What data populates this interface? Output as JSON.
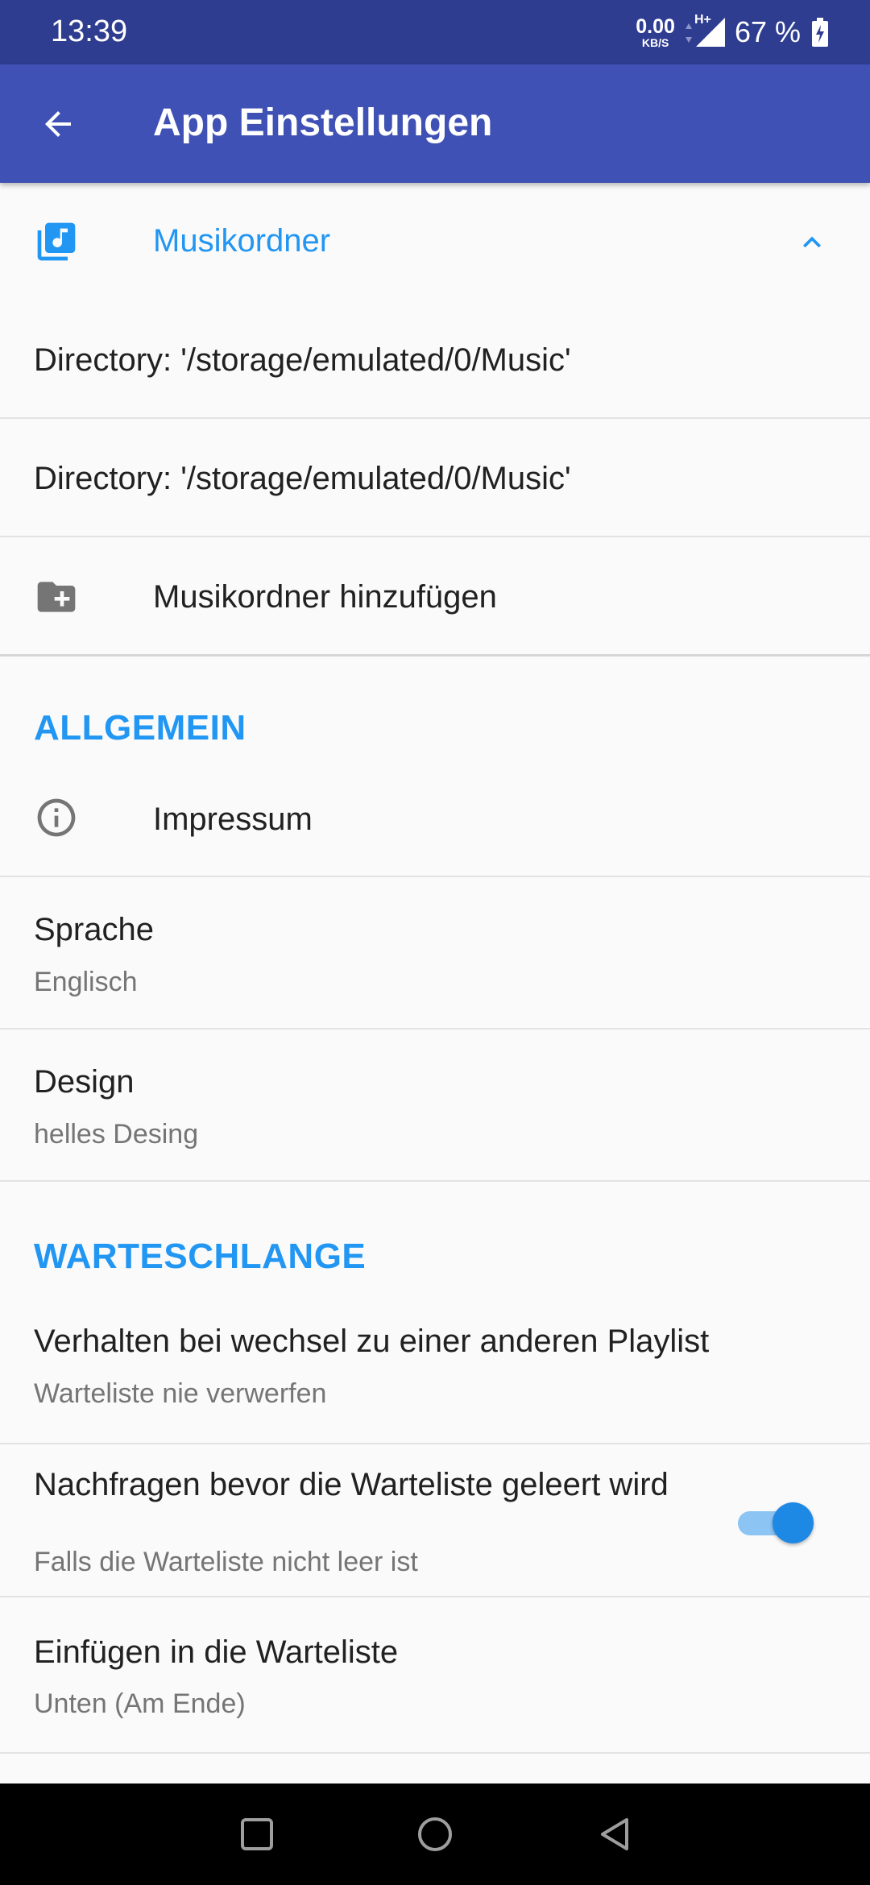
{
  "status_bar": {
    "time": "13:39",
    "net_speed_value": "0.00",
    "net_speed_unit": "KB/S",
    "network_type": "H+",
    "battery_percent": "67 %"
  },
  "app_bar": {
    "title": "App Einstellungen"
  },
  "music_folders": {
    "header_label": "Musikordner",
    "directories": [
      "Directory: '/storage/emulated/0/Music'",
      "Directory: '/storage/emulated/0/Music'"
    ],
    "add_label": "Musikordner hinzufügen"
  },
  "general": {
    "header": "ALLGEMEIN",
    "imprint_label": "Impressum",
    "language_title": "Sprache",
    "language_value": "Englisch",
    "design_title": "Design",
    "design_value": "helles Desing"
  },
  "queue": {
    "header": "WARTESCHLANGE",
    "behavior_title": "Verhalten bei wechsel zu einer anderen Playlist",
    "behavior_value": "Warteliste nie verwerfen",
    "confirm_title": "Nachfragen bevor die Warteliste geleert wird",
    "confirm_subtitle": "Falls die Warteliste nicht leer ist",
    "confirm_enabled": true,
    "insert_title": "Einfügen in die Warteliste",
    "insert_value": "Unten (Am Ende)"
  },
  "colors": {
    "status_bar": "#2f3d91",
    "app_bar": "#3f51b5",
    "accent": "#2196f3",
    "switch_thumb": "#1e88e5",
    "switch_track": "#8cc4f4"
  },
  "icons": {
    "back": "arrow-left-icon",
    "music_folder": "music-library-icon",
    "collapse": "chevron-up-icon",
    "add_folder": "folder-plus-icon",
    "info": "info-icon",
    "nav_recents": "square-icon",
    "nav_home": "circle-icon",
    "nav_back": "triangle-back-icon"
  }
}
